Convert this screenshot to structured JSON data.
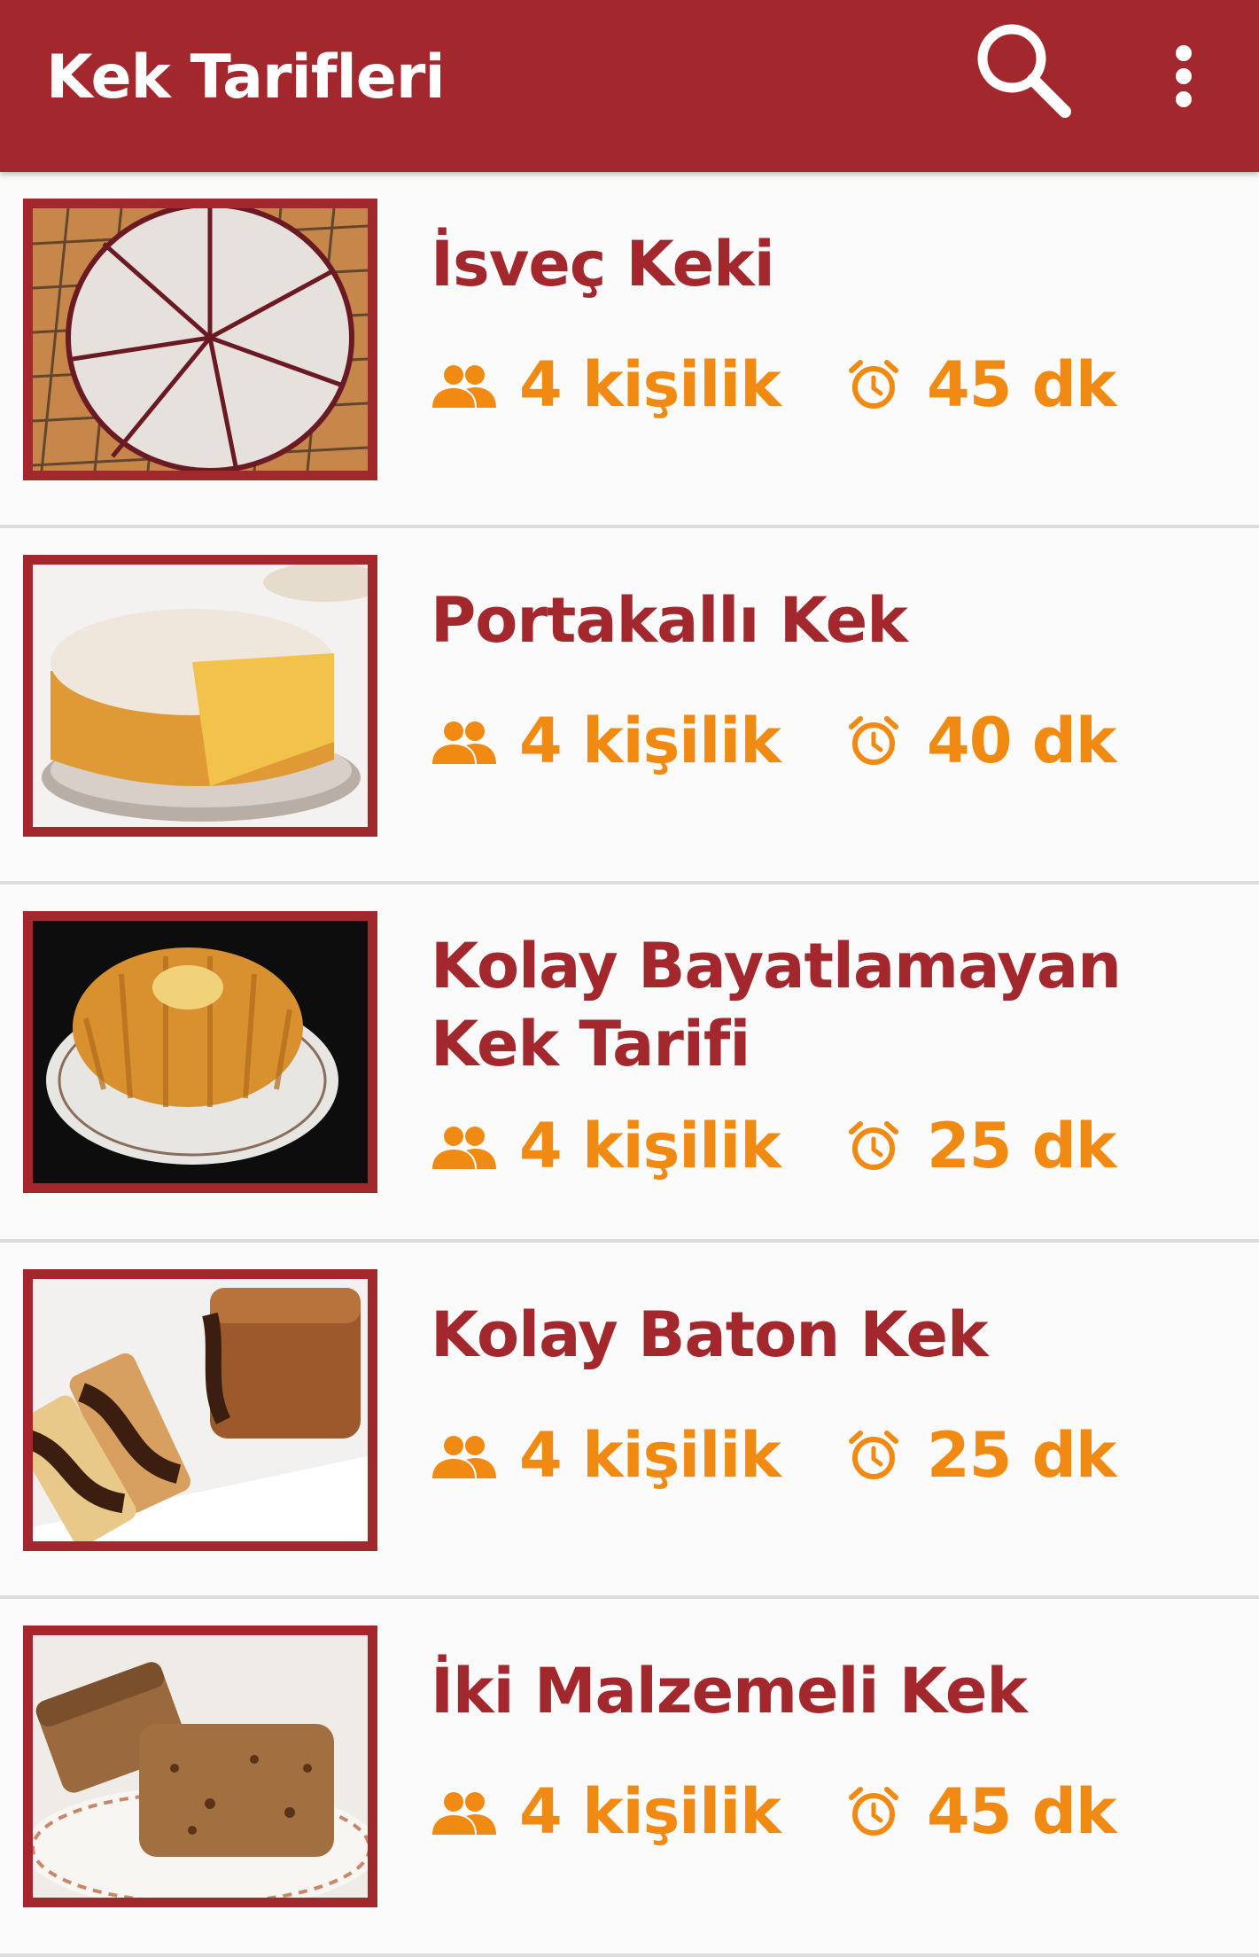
{
  "app": {
    "title": "Kek Tarifleri"
  },
  "toolbar": {
    "search_icon": "search-icon",
    "more_icon": "more-vert-icon"
  },
  "colors": {
    "primary": "#a3282d",
    "accent": "#f08a12",
    "background": "#f9f9f9"
  },
  "recipes": [
    {
      "title": "İsveç Keki",
      "servings": "4 kişilik",
      "duration": "45 dk",
      "image": "dark-cake-with-powdered-sugar"
    },
    {
      "title": "Portakallı Kek",
      "servings": "4 kişilik",
      "duration": "40 dk",
      "image": "orange-sponge-cake"
    },
    {
      "title": "Kolay Bayatlamayan Kek Tarifi",
      "servings": "4 kişilik",
      "duration": "25 dk",
      "image": "bundt-cake-on-plate"
    },
    {
      "title": "Kolay Baton Kek",
      "servings": "4 kişilik",
      "duration": "25 dk",
      "image": "marble-loaf-cake"
    },
    {
      "title": "İki Malzemeli Kek",
      "servings": "4 kişilik",
      "duration": "45 dk",
      "image": "brown-cake-slices"
    }
  ]
}
